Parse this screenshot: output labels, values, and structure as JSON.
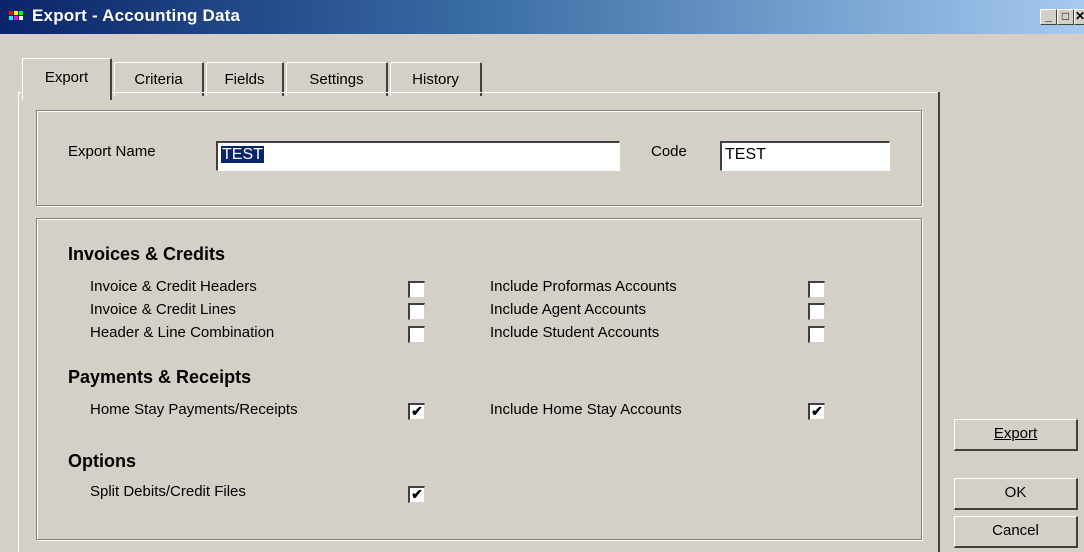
{
  "window": {
    "title": "Export - Accounting Data",
    "min_glyph": "_",
    "max_glyph": "□",
    "close_glyph": "✕"
  },
  "tabs": [
    "Export",
    "Criteria",
    "Fields",
    "Settings",
    "History"
  ],
  "active_tab": "Export",
  "export_name": {
    "label": "Export Name",
    "value": "TEST"
  },
  "code": {
    "label": "Code",
    "value": "TEST"
  },
  "sections": {
    "invoices": {
      "title": "Invoices & Credits",
      "left": [
        {
          "label": "Invoice & Credit Headers",
          "checked": false
        },
        {
          "label": "Invoice & Credit Lines",
          "checked": false
        },
        {
          "label": "Header & Line Combination",
          "checked": false
        }
      ],
      "right": [
        {
          "label": "Include Proformas Accounts",
          "checked": false
        },
        {
          "label": "Include Agent Accounts",
          "checked": false
        },
        {
          "label": "Include Student Accounts",
          "checked": false
        }
      ]
    },
    "payments": {
      "title": "Payments & Receipts",
      "left": [
        {
          "label": "Home Stay Payments/Receipts",
          "checked": true
        }
      ],
      "right": [
        {
          "label": "Include Home Stay Accounts",
          "checked": true
        }
      ]
    },
    "options": {
      "title": "Options",
      "left": [
        {
          "label": "Split Debits/Credit Files",
          "checked": true
        }
      ]
    }
  },
  "buttons": {
    "export": {
      "label": "Export"
    },
    "ok": {
      "label": "OK"
    },
    "cancel": {
      "label": "Cancel"
    }
  }
}
